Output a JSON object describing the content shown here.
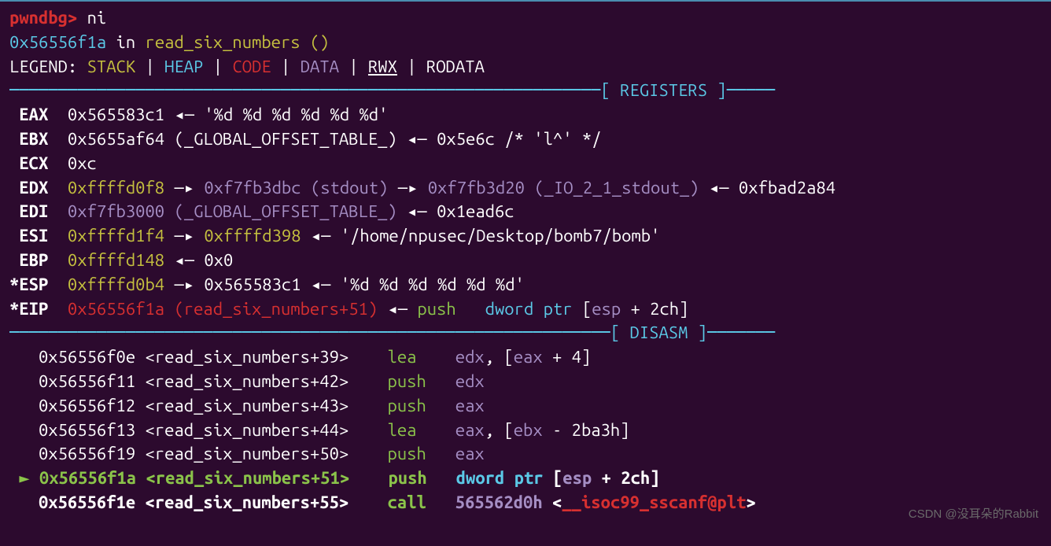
{
  "prompt": "pwndbg>",
  "command": "ni",
  "exec_line": {
    "addr": "0x56556f1a",
    "in": "in",
    "func": "read_six_numbers ()"
  },
  "legend": {
    "label": "LEGEND:",
    "stack": "STACK",
    "heap": "HEAP",
    "code": "CODE",
    "data": "DATA",
    "rwx": "RWX",
    "rodata": "RODATA"
  },
  "sections": {
    "registers": "─────────────────────────────────────────────────────────────[ REGISTERS ]─────",
    "disasm": "──────────────────────────────────────────────────────────────[ DISASM ]───────"
  },
  "registers": {
    "eax": {
      "name": " EAX",
      "val": "0x565583c1",
      "arrow": "◂—",
      "str": "'%d %d %d %d %d %d'"
    },
    "ebx": {
      "name": " EBX",
      "val": "0x5655af64",
      "sym": "(_GLOBAL_OFFSET_TABLE_)",
      "arrow": "◂—",
      "p1": "0x5e6c",
      "cmt": "/* 'l^' */"
    },
    "ecx": {
      "name": " ECX",
      "val": "0xc"
    },
    "edx": {
      "name": " EDX",
      "val": "0xffffd0f8",
      "a1": "—▸",
      "p1": "0xf7fb3dbc",
      "s1": "(stdout)",
      "a2": "—▸",
      "p2": "0xf7fb3d20",
      "s2": "(_IO_2_1_stdout_)",
      "a3": "◂—",
      "p3": "0xfbad2a84"
    },
    "edi": {
      "name": " EDI",
      "val": "0xf7fb3000",
      "sym": "(_GLOBAL_OFFSET_TABLE_)",
      "a1": "◂—",
      "p1": "0x1ead6c"
    },
    "esi": {
      "name": " ESI",
      "val": "0xffffd1f4",
      "a1": "—▸",
      "p1": "0xffffd398",
      "a2": "◂—",
      "str": "'/home/npusec/Desktop/bomb7/bomb'"
    },
    "ebp": {
      "name": " EBP",
      "val": "0xffffd148",
      "a1": "◂—",
      "p1": "0x0"
    },
    "esp": {
      "name": "*ESP",
      "val": "0xffffd0b4",
      "a1": "—▸",
      "p1": "0x565583c1",
      "a2": "◂—",
      "str": "'%d %d %d %d %d %d'"
    },
    "eip": {
      "name": "*EIP",
      "val": "0x56556f1a",
      "sym": "(read_six_numbers+51)",
      "a1": "◂—",
      "op": "push",
      "arg0": "dword ptr",
      "arg1": "[",
      "arg2": "esp",
      "arg3": "+",
      "arg4": "2ch",
      "arg5": "]"
    }
  },
  "disasm": [
    {
      "cur": false,
      "addr": "0x56556f0e",
      "lb": "<",
      "sym": "read_six_numbers+39",
      "rb": ">",
      "op": "lea",
      "a0": "edx",
      "a1": ", [",
      "a2": "eax",
      "a3": " + ",
      "a4": "4",
      "a5": "]"
    },
    {
      "cur": false,
      "addr": "0x56556f11",
      "lb": "<",
      "sym": "read_six_numbers+42",
      "rb": ">",
      "op": "push",
      "a0": "edx"
    },
    {
      "cur": false,
      "addr": "0x56556f12",
      "lb": "<",
      "sym": "read_six_numbers+43",
      "rb": ">",
      "op": "push",
      "a0": "eax"
    },
    {
      "cur": false,
      "addr": "0x56556f13",
      "lb": "<",
      "sym": "read_six_numbers+44",
      "rb": ">",
      "op": "lea",
      "a0": "eax",
      "a1": ", [",
      "a2": "ebx",
      "a3": " - ",
      "a4": "2ba3h",
      "a5": "]"
    },
    {
      "cur": false,
      "addr": "0x56556f19",
      "lb": "<",
      "sym": "read_six_numbers+50",
      "rb": ">",
      "op": "push",
      "a0": "eax"
    },
    {
      "cur": true,
      "mark": " ►",
      "addr": "0x56556f1a",
      "lb": "<",
      "sym": "read_six_numbers+51",
      "rb": ">",
      "op": "push",
      "a0": "dword ptr",
      "a1": " [",
      "a2": "esp",
      "a3": " + ",
      "a4": "2ch",
      "a5": "]"
    },
    {
      "cur": false,
      "addr": "0x56556f1e",
      "lb": "<",
      "sym": "read_six_numbers+55",
      "rb": ">",
      "op": "call",
      "a0": "565562d0h",
      "a1": " <",
      "call": "__isoc99_sscanf@plt",
      "a2": ">"
    }
  ],
  "watermark": "CSDN @没耳朵的Rabbit"
}
